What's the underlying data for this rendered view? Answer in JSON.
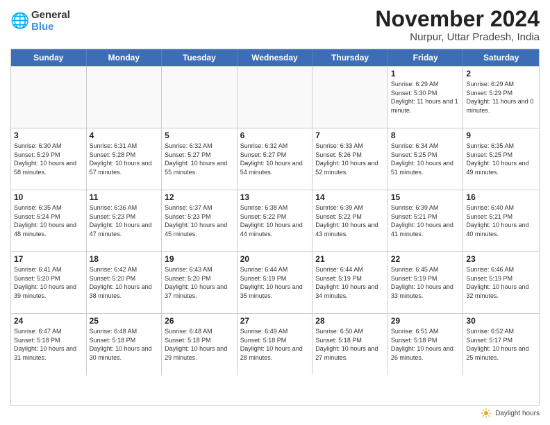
{
  "logo": {
    "general": "General",
    "blue": "Blue"
  },
  "title": "November 2024",
  "location": "Nurpur, Uttar Pradesh, India",
  "days_of_week": [
    "Sunday",
    "Monday",
    "Tuesday",
    "Wednesday",
    "Thursday",
    "Friday",
    "Saturday"
  ],
  "legend_label": "Daylight hours",
  "weeks": [
    [
      {
        "day": "",
        "empty": true
      },
      {
        "day": "",
        "empty": true
      },
      {
        "day": "",
        "empty": true
      },
      {
        "day": "",
        "empty": true
      },
      {
        "day": "",
        "empty": true
      },
      {
        "day": "1",
        "sunrise": "Sunrise: 6:29 AM",
        "sunset": "Sunset: 5:30 PM",
        "daylight": "Daylight: 11 hours and 1 minute."
      },
      {
        "day": "2",
        "sunrise": "Sunrise: 6:29 AM",
        "sunset": "Sunset: 5:29 PM",
        "daylight": "Daylight: 11 hours and 0 minutes."
      }
    ],
    [
      {
        "day": "3",
        "sunrise": "Sunrise: 6:30 AM",
        "sunset": "Sunset: 5:29 PM",
        "daylight": "Daylight: 10 hours and 58 minutes."
      },
      {
        "day": "4",
        "sunrise": "Sunrise: 6:31 AM",
        "sunset": "Sunset: 5:28 PM",
        "daylight": "Daylight: 10 hours and 57 minutes."
      },
      {
        "day": "5",
        "sunrise": "Sunrise: 6:32 AM",
        "sunset": "Sunset: 5:27 PM",
        "daylight": "Daylight: 10 hours and 55 minutes."
      },
      {
        "day": "6",
        "sunrise": "Sunrise: 6:32 AM",
        "sunset": "Sunset: 5:27 PM",
        "daylight": "Daylight: 10 hours and 54 minutes."
      },
      {
        "day": "7",
        "sunrise": "Sunrise: 6:33 AM",
        "sunset": "Sunset: 5:26 PM",
        "daylight": "Daylight: 10 hours and 52 minutes."
      },
      {
        "day": "8",
        "sunrise": "Sunrise: 6:34 AM",
        "sunset": "Sunset: 5:25 PM",
        "daylight": "Daylight: 10 hours and 51 minutes."
      },
      {
        "day": "9",
        "sunrise": "Sunrise: 6:35 AM",
        "sunset": "Sunset: 5:25 PM",
        "daylight": "Daylight: 10 hours and 49 minutes."
      }
    ],
    [
      {
        "day": "10",
        "sunrise": "Sunrise: 6:35 AM",
        "sunset": "Sunset: 5:24 PM",
        "daylight": "Daylight: 10 hours and 48 minutes."
      },
      {
        "day": "11",
        "sunrise": "Sunrise: 6:36 AM",
        "sunset": "Sunset: 5:23 PM",
        "daylight": "Daylight: 10 hours and 47 minutes."
      },
      {
        "day": "12",
        "sunrise": "Sunrise: 6:37 AM",
        "sunset": "Sunset: 5:23 PM",
        "daylight": "Daylight: 10 hours and 45 minutes."
      },
      {
        "day": "13",
        "sunrise": "Sunrise: 6:38 AM",
        "sunset": "Sunset: 5:22 PM",
        "daylight": "Daylight: 10 hours and 44 minutes."
      },
      {
        "day": "14",
        "sunrise": "Sunrise: 6:39 AM",
        "sunset": "Sunset: 5:22 PM",
        "daylight": "Daylight: 10 hours and 43 minutes."
      },
      {
        "day": "15",
        "sunrise": "Sunrise: 6:39 AM",
        "sunset": "Sunset: 5:21 PM",
        "daylight": "Daylight: 10 hours and 41 minutes."
      },
      {
        "day": "16",
        "sunrise": "Sunrise: 6:40 AM",
        "sunset": "Sunset: 5:21 PM",
        "daylight": "Daylight: 10 hours and 40 minutes."
      }
    ],
    [
      {
        "day": "17",
        "sunrise": "Sunrise: 6:41 AM",
        "sunset": "Sunset: 5:20 PM",
        "daylight": "Daylight: 10 hours and 39 minutes."
      },
      {
        "day": "18",
        "sunrise": "Sunrise: 6:42 AM",
        "sunset": "Sunset: 5:20 PM",
        "daylight": "Daylight: 10 hours and 38 minutes."
      },
      {
        "day": "19",
        "sunrise": "Sunrise: 6:43 AM",
        "sunset": "Sunset: 5:20 PM",
        "daylight": "Daylight: 10 hours and 37 minutes."
      },
      {
        "day": "20",
        "sunrise": "Sunrise: 6:44 AM",
        "sunset": "Sunset: 5:19 PM",
        "daylight": "Daylight: 10 hours and 35 minutes."
      },
      {
        "day": "21",
        "sunrise": "Sunrise: 6:44 AM",
        "sunset": "Sunset: 5:19 PM",
        "daylight": "Daylight: 10 hours and 34 minutes."
      },
      {
        "day": "22",
        "sunrise": "Sunrise: 6:45 AM",
        "sunset": "Sunset: 5:19 PM",
        "daylight": "Daylight: 10 hours and 33 minutes."
      },
      {
        "day": "23",
        "sunrise": "Sunrise: 6:46 AM",
        "sunset": "Sunset: 5:19 PM",
        "daylight": "Daylight: 10 hours and 32 minutes."
      }
    ],
    [
      {
        "day": "24",
        "sunrise": "Sunrise: 6:47 AM",
        "sunset": "Sunset: 5:18 PM",
        "daylight": "Daylight: 10 hours and 31 minutes."
      },
      {
        "day": "25",
        "sunrise": "Sunrise: 6:48 AM",
        "sunset": "Sunset: 5:18 PM",
        "daylight": "Daylight: 10 hours and 30 minutes."
      },
      {
        "day": "26",
        "sunrise": "Sunrise: 6:48 AM",
        "sunset": "Sunset: 5:18 PM",
        "daylight": "Daylight: 10 hours and 29 minutes."
      },
      {
        "day": "27",
        "sunrise": "Sunrise: 6:49 AM",
        "sunset": "Sunset: 5:18 PM",
        "daylight": "Daylight: 10 hours and 28 minutes."
      },
      {
        "day": "28",
        "sunrise": "Sunrise: 6:50 AM",
        "sunset": "Sunset: 5:18 PM",
        "daylight": "Daylight: 10 hours and 27 minutes."
      },
      {
        "day": "29",
        "sunrise": "Sunrise: 6:51 AM",
        "sunset": "Sunset: 5:18 PM",
        "daylight": "Daylight: 10 hours and 26 minutes."
      },
      {
        "day": "30",
        "sunrise": "Sunrise: 6:52 AM",
        "sunset": "Sunset: 5:17 PM",
        "daylight": "Daylight: 10 hours and 25 minutes."
      }
    ]
  ]
}
